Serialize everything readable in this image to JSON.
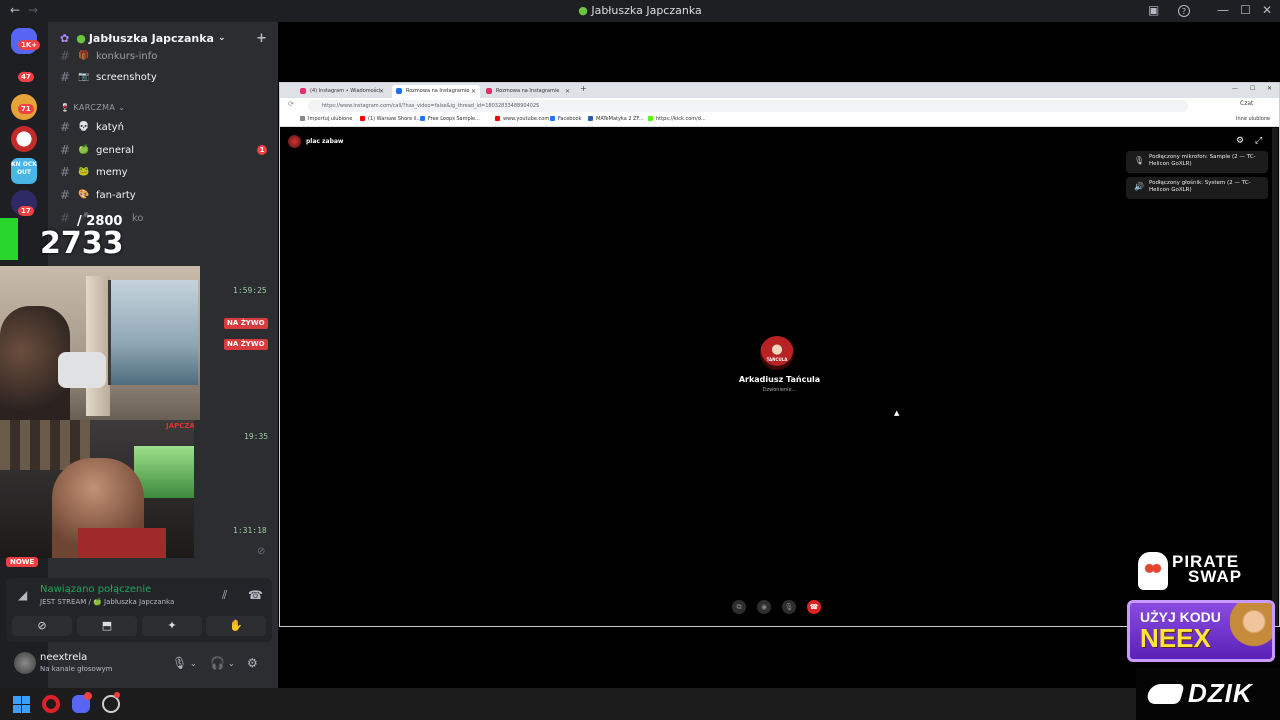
{
  "window": {
    "title": "Jabłuszka Japczanka",
    "back": "←",
    "forward": "→",
    "minimize": "—",
    "maximize": "☐",
    "close": "✕",
    "inbox": "▣",
    "help": "?"
  },
  "rail": {
    "badges": [
      "1K+",
      "47",
      "71",
      "17"
    ],
    "knockout_label": "KN OCK OUT"
  },
  "guild": {
    "name": "Jabłuszka Japczanka",
    "chevron": "⌄",
    "invite_icon": "+"
  },
  "channels": [
    {
      "name": "konkurs-info",
      "emoji": "🎁"
    },
    {
      "name": "screenshoty",
      "emoji": "📷"
    },
    {
      "category": "KARCZMA"
    },
    {
      "name": "katyń",
      "emoji": "💀"
    },
    {
      "name": "general",
      "emoji": "🍏",
      "unread": "1"
    },
    {
      "name": "memy",
      "emoji": "🐸"
    },
    {
      "name": "fan-arty",
      "emoji": "🎨"
    },
    {
      "name": "ko",
      "emoji": "🎤"
    }
  ],
  "overlay": {
    "counter": "2733",
    "goal": "/ 2800",
    "cam2_tag": "JAPCZAN"
  },
  "stream_times": [
    "1:59:25",
    "19:35",
    "1:31:18"
  ],
  "live_label": "NA ŻYWO",
  "new_label": "NOWE",
  "voice": {
    "status": "Nawiązano połączenie",
    "detail": "JEST STREAM / 🍏 Jabłuszka Japczanka",
    "buttons": [
      "⊘",
      "⬒",
      "✦",
      "✋"
    ]
  },
  "user": {
    "name": "neextrela",
    "status": "Na kanale głosowym"
  },
  "browser": {
    "tabs": [
      {
        "label": "(4) Instagram • Wiadomości",
        "active": false
      },
      {
        "label": "Rozmowa na Instagramie",
        "active": true
      },
      {
        "label": "Rozmowa na Instagramie",
        "active": false
      }
    ],
    "new_tab": "+",
    "url": "https://www.instagram.com/call/?has_video=false&ig_thread_id=18032833488904025",
    "bookmarks": [
      {
        "label": "Importuj ulubione",
        "color": "#888888"
      },
      {
        "label": "(1) Warsaw Shore il...",
        "color": "#ff0000"
      },
      {
        "label": "Free Loops Sample...",
        "color": "#1877f2"
      },
      {
        "label": "www.youtube.com",
        "color": "#ff0000"
      },
      {
        "label": "Facebook",
        "color": "#1877f2"
      },
      {
        "label": "MATeMatyka 2 ZF...",
        "color": "#2a5db0"
      },
      {
        "label": "https://kick.com/d...",
        "color": "#53fc18"
      }
    ],
    "other_bookmarks": "Inne ulubione",
    "profile": "Czat"
  },
  "call": {
    "room_name": "plac zabaw",
    "notices": [
      {
        "icon": "🎙",
        "text": "Podłączony mikrofon: Sample (2 — TC-Helicon GoXLR)"
      },
      {
        "icon": "🔊",
        "text": "Podłączony głośnik: System (2 — TC-Helicon GoXLR)"
      }
    ],
    "callee": "Arkadiusz Tańcula",
    "callee_avatar_text": "TAŃCULA",
    "state": "Dzwonienie...",
    "controls": [
      "⧉",
      "◉",
      "🎙",
      "☎"
    ]
  },
  "sponsors": {
    "pirate_line1": "PIRATE",
    "pirate_line2": "SWAP",
    "code_line1": "UŻYJ KODU",
    "code_line2": "NEEX",
    "dzik": "DZIK"
  }
}
